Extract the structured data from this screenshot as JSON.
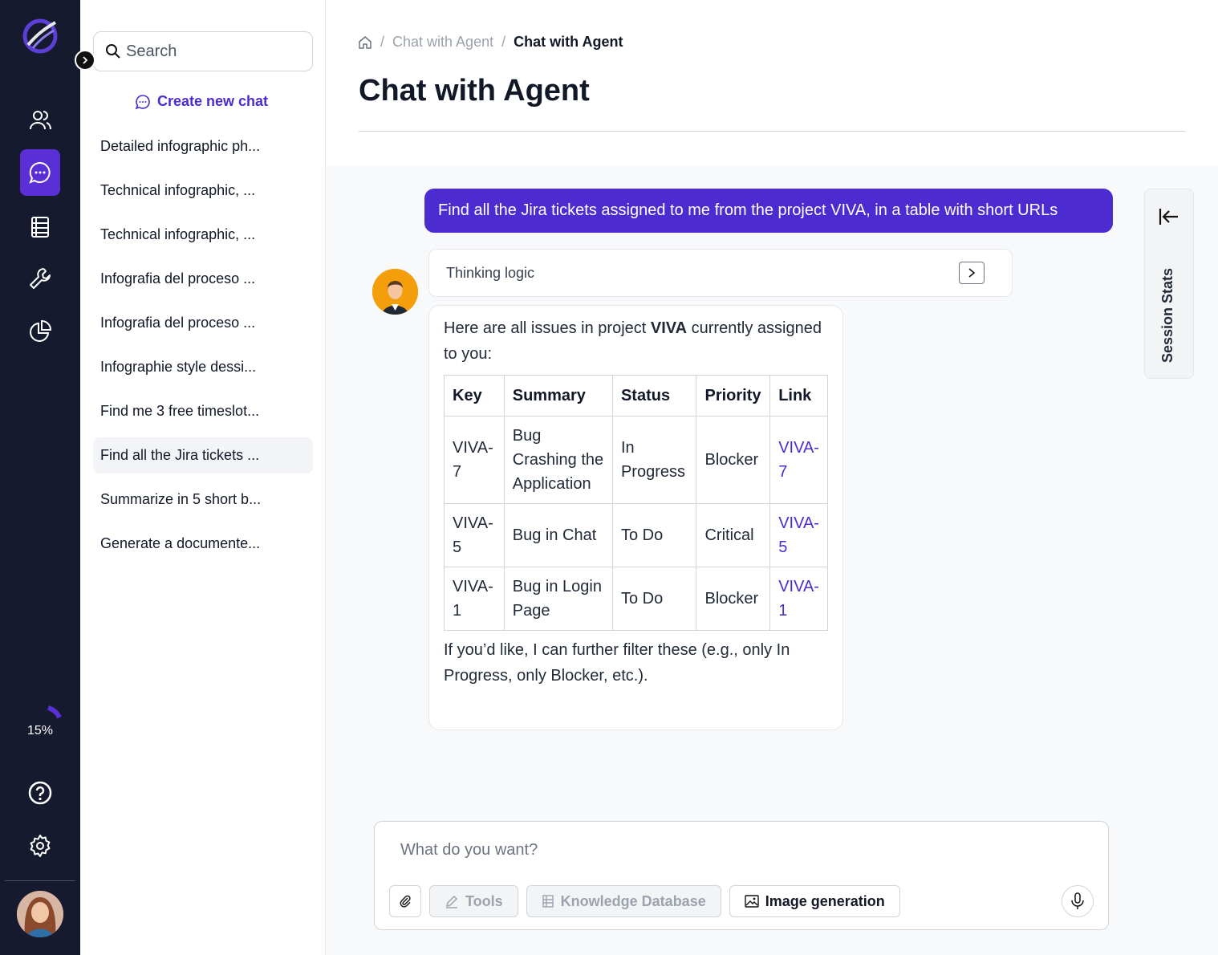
{
  "sidebar": {
    "nav": [
      "users",
      "chat",
      "documents",
      "tools",
      "analytics"
    ],
    "usage_percent": "15%",
    "usage_fraction": 0.15,
    "accent": "#4c2bd0"
  },
  "chat_panel": {
    "search_placeholder": "Search",
    "create_new_chat": "Create new chat",
    "chats": [
      "Detailed infographic ph...",
      "Technical infographic, ...",
      "Technical infographic, ...",
      "Infografia del proceso ...",
      "Infografia del proceso ...",
      "Infographie style dessi...",
      "Find me 3 free timeslot...",
      "Find all the Jira tickets ...",
      "Summarize in 5 short b...",
      "Generate a documente..."
    ],
    "active_index": 7
  },
  "header": {
    "breadcrumb_parent": "Chat with Agent",
    "breadcrumb_current": "Chat with Agent",
    "title": "Chat with Agent"
  },
  "conversation": {
    "user_message": "Find all the Jira tickets assigned to me from the project VIVA, in a table with short URLs",
    "thinking_label": "Thinking logic",
    "reply_intro_before": "Here are all issues in project ",
    "reply_intro_bold": "VIVA",
    "reply_intro_after": " currently assigned to you:",
    "table": {
      "headers": [
        "Key",
        "Summary",
        "Status",
        "Priority",
        "Link"
      ],
      "rows": [
        [
          "VIVA-7",
          "Bug Crashing the Application",
          "In Progress",
          "Blocker",
          "VIVA-7"
        ],
        [
          "VIVA-5",
          "Bug in Chat",
          "To Do",
          "Critical",
          "VIVA-5"
        ],
        [
          "VIVA-1",
          "Bug in Login Page",
          "To Do",
          "Blocker",
          "VIVA-1"
        ]
      ]
    },
    "reply_outro": "If you’d like, I can further filter these (e.g., only In Progress, only Blocker, etc.)."
  },
  "session_stats": {
    "label": "Session Stats"
  },
  "composer": {
    "placeholder": "What do you want?",
    "tools": "Tools",
    "knowledge_database": "Knowledge Database",
    "image_generation": "Image generation"
  }
}
